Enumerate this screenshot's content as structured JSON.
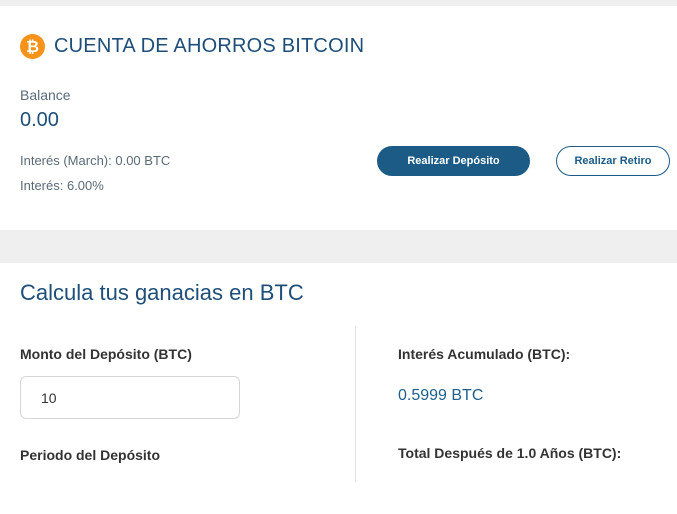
{
  "account": {
    "icon": "bitcoin-icon",
    "title": "CUENTA DE AHORROS BITCOIN",
    "balance_label": "Balance",
    "balance_value": "0.00",
    "interest_month": "Interés (March): 0.00 BTC",
    "interest_rate": "Interés: 6.00%",
    "deposit_button": "Realizar Depósito",
    "withdraw_button": "Realizar Retiro",
    "colors": {
      "accent": "#1c5b86",
      "bitcoin": "#f7931a"
    }
  },
  "calculator": {
    "title": "Calcula tus ganacias en BTC",
    "amount_label": "Monto del Depósito (BTC)",
    "amount_value": "10",
    "period_label": "Periodo del Depósito",
    "accumulated_label": "Interés Acumulado (BTC):",
    "accumulated_value": "0.5999 BTC",
    "total_label": "Total Después de 1.0 Años (BTC):"
  }
}
